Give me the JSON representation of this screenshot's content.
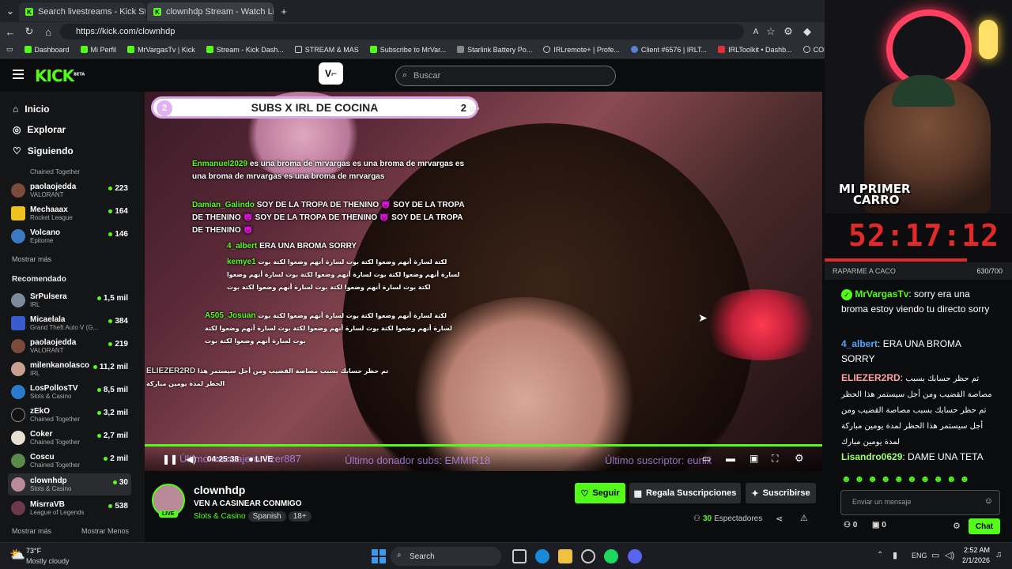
{
  "browser": {
    "tabs": [
      {
        "title": "Search livestreams - Kick Streaming"
      },
      {
        "title": "clownhdp Stream - Watch Live on"
      }
    ],
    "url": "https://kick.com/clownhdp",
    "bookmarks": [
      {
        "label": "Dashboard",
        "icon": "kick-icon"
      },
      {
        "label": "Mi Perfil",
        "icon": "kick-icon"
      },
      {
        "label": "MrVargasTv | Kick",
        "icon": "kick-icon"
      },
      {
        "label": "Stream - Kick Dash...",
        "icon": "kick-icon"
      },
      {
        "label": "STREAM & MAS",
        "icon": "folder-icon"
      },
      {
        "label": "Subscribe to MrVar...",
        "icon": "kick-icon"
      },
      {
        "label": "Starlink Battery Po...",
        "icon": "page-icon"
      },
      {
        "label": "IRLremote+ | Profe...",
        "icon": "globe-icon"
      },
      {
        "label": "Client #6576 | IRLT...",
        "icon": "person-icon"
      },
      {
        "label": "IRLToolkit • Dashb...",
        "icon": "irl-icon"
      },
      {
        "label": "CONTADOR",
        "icon": "contador-icon"
      }
    ]
  },
  "header": {
    "logo": "KICK",
    "logo_badge": "BETA",
    "search_placeholder": "Buscar"
  },
  "sidebar": {
    "nav": [
      {
        "label": "Inicio",
        "icon": "home-icon"
      },
      {
        "label": "Explorar",
        "icon": "compass-icon"
      },
      {
        "label": "Siguiendo",
        "icon": "heart-icon"
      }
    ],
    "following_partial_game": "Chained Together",
    "following": [
      {
        "name": "paolaojedda",
        "game": "VALORANT",
        "viewers": "223"
      },
      {
        "name": "Mechaaax",
        "game": "Rocket League",
        "viewers": "164"
      },
      {
        "name": "Volcano",
        "game": "Epitome",
        "viewers": "146"
      }
    ],
    "show_more": "Mostrar más",
    "recommended_title": "Recomendado",
    "recommended": [
      {
        "name": "SrPulsera",
        "game": "IRL",
        "viewers": "1,5 mil"
      },
      {
        "name": "Micaelala",
        "game": "Grand Theft Auto V (G...",
        "viewers": "384"
      },
      {
        "name": "paolaojedda",
        "game": "VALORANT",
        "viewers": "219"
      },
      {
        "name": "milenkanolasco",
        "game": "IRL",
        "viewers": "11,2 mil"
      },
      {
        "name": "LosPollosTV",
        "game": "Slots & Casino",
        "viewers": "8,5 mil"
      },
      {
        "name": "zEkO",
        "game": "Chained Together",
        "viewers": "3,2 mil"
      },
      {
        "name": "Coker",
        "game": "Chained Together",
        "viewers": "2,7 mil"
      },
      {
        "name": "Coscu",
        "game": "Chained Together",
        "viewers": "2 mil"
      },
      {
        "name": "clownhdp",
        "game": "Slots & Casino",
        "viewers": "30"
      },
      {
        "name": "MisrraVB",
        "game": "League of Legends",
        "viewers": "538"
      }
    ],
    "show_more_bottom": "Mostrar más",
    "show_less": "Mostrar Menos"
  },
  "video": {
    "banner_num": "2",
    "banner_text": "SUBS X IRL DE COCINA",
    "banner_right_num": "2",
    "overlay_chat": [
      {
        "user": "Enmanuel2029",
        "text": "es una broma de mrvargas es una broma de mrvargas es una broma de mrvargas es una broma de mrvargas"
      },
      {
        "user": "Damian_Galindo",
        "text": "SOY DE LA TROPA DE THENINO 👿 SOY DE LA TROPA DE THENINO 👿 SOY DE LA TROPA DE THENINO 👿 SOY DE LA TROPA DE THENINO 👿"
      },
      {
        "user": "4_albert",
        "text": "ERA UNA BROMA SORRY"
      },
      {
        "user": "kemye1",
        "text": "لكتة لسارة أنهم وضعوا لكتة بوت لسارة أنهم وضعوا لكتة بوت لسارة أنهم وضعوا لكتة بوت لسارة أنهم وضعوا لكتة بوت لسارة أنهم وضعوا لكتة بوت لسارة أنهم وضعوا لكتة بوت لسارة أنهم وضعوا لكتة بوت"
      },
      {
        "user": "A505_Josuan",
        "text": "لكتة لسارة أنهم وضعوا لكتة بوت لسارة أنهم وضعوا لكتة بوت لسارة أنهم وضعوا لكتة بوت لسارة أنهم وضعوا لكتة بوت لسارة أنهم وضعوا لكتة بوت لسارة أنهم وضعوا لكتة بوت"
      },
      {
        "user": "ELIEZER2RD",
        "text": "تم حظر حسابك بسبب مصاصة القضيب ومن أجل سيستمر هذا الحظر لمدة يومين مباركة"
      }
    ],
    "time": "04:25:38",
    "live_label": "LIVE",
    "ticker_left": "Último mensajero: lizer887",
    "ticker_mid": "Último donador subs: EMMIR18",
    "ticker_right": "Último suscriptor: eunix"
  },
  "stream_info": {
    "name": "clownhdp",
    "title": "VEN A CASINEAR CONMIGO",
    "category": "Slots & Casino",
    "tags": [
      "Spanish",
      "18+"
    ],
    "live_badge": "LIVE",
    "follow_label": "Seguir",
    "gift_label": "Regala Suscripciones",
    "subscribe_label": "Suscribirse",
    "viewer_count": "30",
    "viewers_label": "Espectadores"
  },
  "webcam": {
    "sign_line1": "MI PRIMER",
    "sign_line2": "CARRO"
  },
  "timer": "52:17:12",
  "goal": {
    "label": "RAPARME A CACO",
    "value": "630/700"
  },
  "chat": {
    "messages": [
      {
        "user": "MrVargasTv",
        "text": ": sorry era una broma estoy viendo tu directo sorry",
        "color": "#53fc18"
      },
      {
        "user": "4_albert",
        "text": ": ERA UNA BROMA SORRY",
        "color": "#4ea7ff"
      },
      {
        "user": "ELIEZER2RD",
        "text": "تم حظر حسابك بسبب مصاصة القضيب ومن أجل سيستمر هذا الحظر تم حظر حسابك بسبب مصاصة القضيب ومن أجل سيستمر هذا الحظر لمدة يومين مباركة لمدة يومين مبارك",
        "color": "#ff9f9f"
      },
      {
        "user": "Lisandro0629",
        "text": ": DAME UNA TETA",
        "color": "#9eff6a"
      }
    ],
    "input_placeholder": "Enviar un mensaje",
    "points": "0",
    "chest": "0",
    "chat_button": "Chat"
  },
  "taskbar": {
    "weather_temp": "73°F",
    "weather_desc": "Mostly cloudy",
    "search": "Search",
    "lang": "ENG",
    "time": "2:52 AM",
    "date": "2/1/2026"
  }
}
